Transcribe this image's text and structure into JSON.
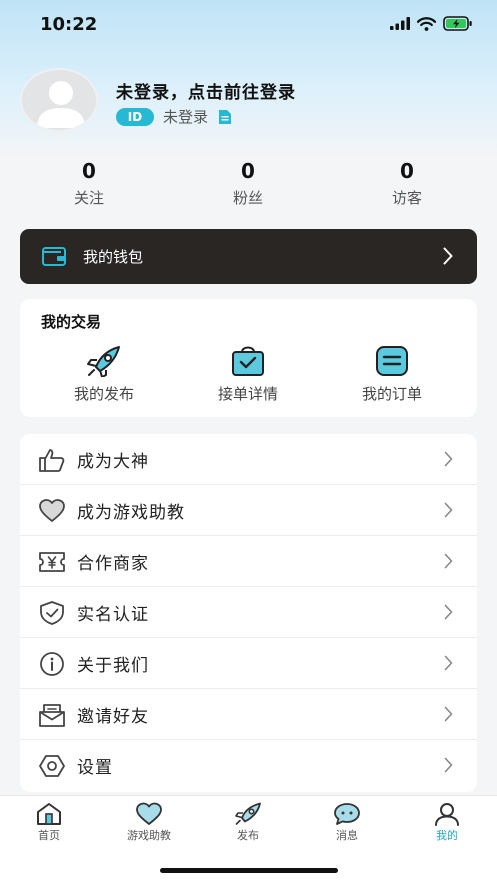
{
  "status_bar": {
    "time": "10:22"
  },
  "profile": {
    "title": "未登录，点击前往登录",
    "id_badge": "ID",
    "id_text": "未登录"
  },
  "stats": [
    {
      "value": "0",
      "label": "关注"
    },
    {
      "value": "0",
      "label": "粉丝"
    },
    {
      "value": "0",
      "label": "访客"
    }
  ],
  "wallet": {
    "label": "我的钱包"
  },
  "trade": {
    "title": "我的交易",
    "items": [
      {
        "label": "我的发布",
        "icon": "rocket-icon"
      },
      {
        "label": "接单详情",
        "icon": "bag-check-icon"
      },
      {
        "label": "我的订单",
        "icon": "order-list-icon"
      }
    ]
  },
  "menu": [
    {
      "label": "成为大神",
      "icon": "crown-hand-icon"
    },
    {
      "label": "成为游戏助教",
      "icon": "heart-icon"
    },
    {
      "label": "合作商家",
      "icon": "yen-ticket-icon"
    },
    {
      "label": "实名认证",
      "icon": "shield-check-icon"
    },
    {
      "label": "关于我们",
      "icon": "info-icon"
    },
    {
      "label": "邀请好友",
      "icon": "invite-mail-icon"
    },
    {
      "label": "设置",
      "icon": "settings-hexagon-icon"
    }
  ],
  "tabbar": [
    {
      "label": "首页",
      "icon": "home-icon"
    },
    {
      "label": "游戏助教",
      "icon": "heart-icon"
    },
    {
      "label": "发布",
      "icon": "rocket-icon"
    },
    {
      "label": "消息",
      "icon": "chat-icon"
    },
    {
      "label": "我的",
      "icon": "user-icon",
      "active": true
    }
  ],
  "colors": {
    "accent": "#27b9d4",
    "wallet_bg": "#2a2624",
    "active_tab": "#22a7c2"
  }
}
